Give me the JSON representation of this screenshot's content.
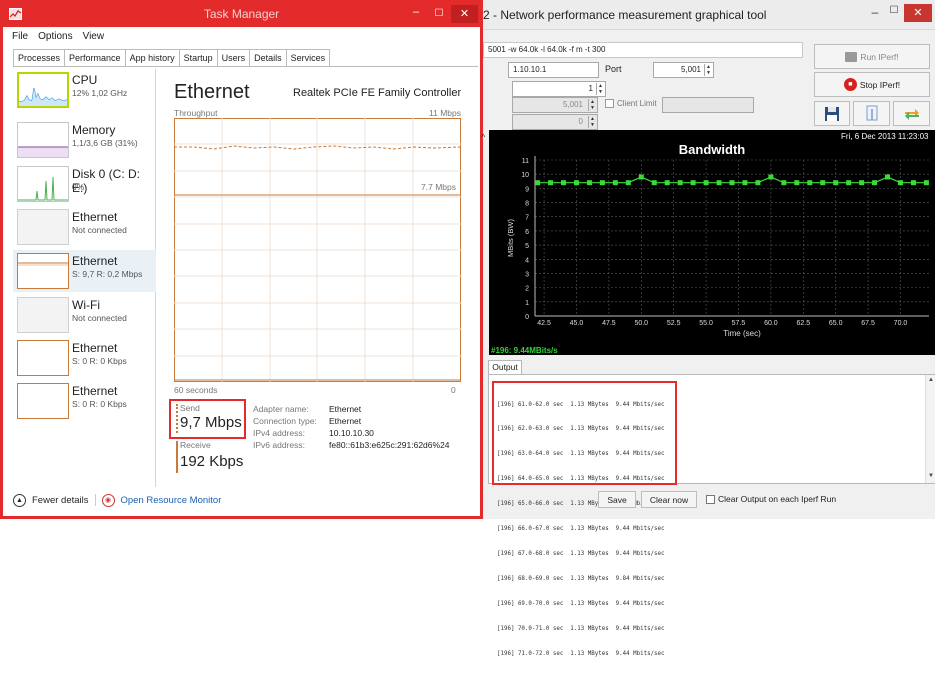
{
  "task_manager": {
    "title": "Task Manager",
    "window_controls": {
      "minimize": "–",
      "maximize": "☐",
      "close": "✕"
    },
    "menu": [
      "File",
      "Options",
      "View"
    ],
    "tabs": [
      "Processes",
      "Performance",
      "App history",
      "Startup",
      "Users",
      "Details",
      "Services"
    ],
    "active_tab": "Performance",
    "sidebar": [
      {
        "name": "CPU",
        "sub": "12% 1,02 GHz",
        "color": "#1a8fd6",
        "selected_outline": "#b7d600"
      },
      {
        "name": "Memory",
        "sub": "1,1/3,6 GB (31%)",
        "color": "#8e44ad"
      },
      {
        "name": "Disk 0 (C: D: E:)",
        "sub": "0%",
        "color": "#4caf50"
      },
      {
        "name": "Ethernet",
        "sub": "Not connected",
        "color": "#a0522d"
      },
      {
        "name": "Ethernet",
        "sub": "S: 9,7 R: 0,2 Mbps",
        "color": "#a0522d"
      },
      {
        "name": "Wi-Fi",
        "sub": "Not connected",
        "color": "#a0522d"
      },
      {
        "name": "Ethernet",
        "sub": "S: 0 R: 0 Kbps",
        "color": "#a0522d"
      },
      {
        "name": "Ethernet",
        "sub": "S: 0 R: 0 Kbps",
        "color": "#a0522d"
      }
    ],
    "main": {
      "heading": "Ethernet",
      "adapter_title": "Realtek PCIe FE Family Controller",
      "throughput_label": "Throughput",
      "max_label": "11 Mbps",
      "mid_label": "7.7 Mbps",
      "time_left_label": "60 seconds",
      "time_right_label": "0",
      "send_label": "Send",
      "send_value": "9,7 Mbps",
      "receive_label": "Receive",
      "receive_value": "192 Kbps",
      "details": [
        {
          "key": "Adapter name:",
          "value": "Ethernet"
        },
        {
          "key": "Connection type:",
          "value": "Ethernet"
        },
        {
          "key": "IPv4 address:",
          "value": "10.10.10.30"
        },
        {
          "key": "IPv6 address:",
          "value": "fe80::61b3:e625c:291:62d6%24"
        }
      ],
      "graph_line_color": "#a0522d"
    },
    "footer": {
      "fewer_details": "Fewer details",
      "open_monitor": "Open Resource Monitor"
    }
  },
  "jperf": {
    "title": "2 - Network performance measurement graphical tool",
    "command": "5001 -w 64.0k -l 64.0k -f m -t 300",
    "host_value": "1.10.10.1",
    "port_label": "Port",
    "port_value": "5,001",
    "parallel_value": "1",
    "listen_port_value": "5,001",
    "client_limit_label": "Client Limit",
    "connections_value": "0",
    "run_button": "Run IPerf!",
    "stop_button": "Stop IPerf!",
    "chart_date": "Fri, 6 Dec 2013 11:23:03",
    "status_text": "#196: 9.44MBits/s",
    "output_tab": "Output",
    "output_lines": [
      "[196] 61.0-62.0 sec  1.13 MBytes  9.44 Mbits/sec",
      "[196] 62.0-63.0 sec  1.13 MBytes  9.44 Mbits/sec",
      "[196] 63.0-64.0 sec  1.13 MBytes  9.44 Mbits/sec",
      "[196] 64.0-65.0 sec  1.13 MBytes  9.44 Mbits/sec",
      "[196] 65.0-66.0 sec  1.13 MBytes  9.44 Mbits/sec",
      "[196] 66.0-67.0 sec  1.13 MBytes  9.44 Mbits/sec",
      "[196] 67.0-68.0 sec  1.13 MBytes  9.44 Mbits/sec",
      "[196] 68.0-69.0 sec  1.13 MBytes  9.84 Mbits/sec",
      "[196] 69.0-70.0 sec  1.13 MBytes  9.44 Mbits/sec",
      "[196] 70.0-71.0 sec  1.13 MBytes  9.44 Mbits/sec",
      "[196] 71.0-72.0 sec  1.13 MBytes  9.44 Mbits/sec"
    ],
    "save_button": "Save",
    "clear_button": "Clear now",
    "clear_on_run_label": "Clear Output on each Iperf Run"
  },
  "chart_data": {
    "type": "line",
    "title": "Bandwidth",
    "xlabel": "Time (sec)",
    "ylabel": "MBits (BW)",
    "xlim": [
      41.8,
      72.2
    ],
    "ylim": [
      0,
      11
    ],
    "xticks": [
      42.5,
      45.0,
      47.5,
      50.0,
      52.5,
      55.0,
      57.5,
      60.0,
      62.5,
      65.0,
      67.5,
      70.0
    ],
    "yticks": [
      0,
      1,
      2,
      3,
      4,
      5,
      6,
      7,
      8,
      9,
      10,
      11
    ],
    "grid": true,
    "series": [
      {
        "color": "#3bd93b",
        "x": [
          42,
          43,
          44,
          45,
          46,
          47,
          48,
          49,
          50,
          51,
          52,
          53,
          54,
          55,
          56,
          57,
          58,
          59,
          60,
          61,
          62,
          63,
          64,
          65,
          66,
          67,
          68,
          69,
          70,
          71,
          72
        ],
        "values": [
          9.4,
          9.4,
          9.4,
          9.4,
          9.4,
          9.4,
          9.4,
          9.4,
          9.8,
          9.4,
          9.4,
          9.4,
          9.4,
          9.4,
          9.4,
          9.4,
          9.4,
          9.4,
          9.8,
          9.4,
          9.4,
          9.4,
          9.4,
          9.4,
          9.4,
          9.4,
          9.4,
          9.8,
          9.4,
          9.4,
          9.4
        ]
      }
    ]
  }
}
